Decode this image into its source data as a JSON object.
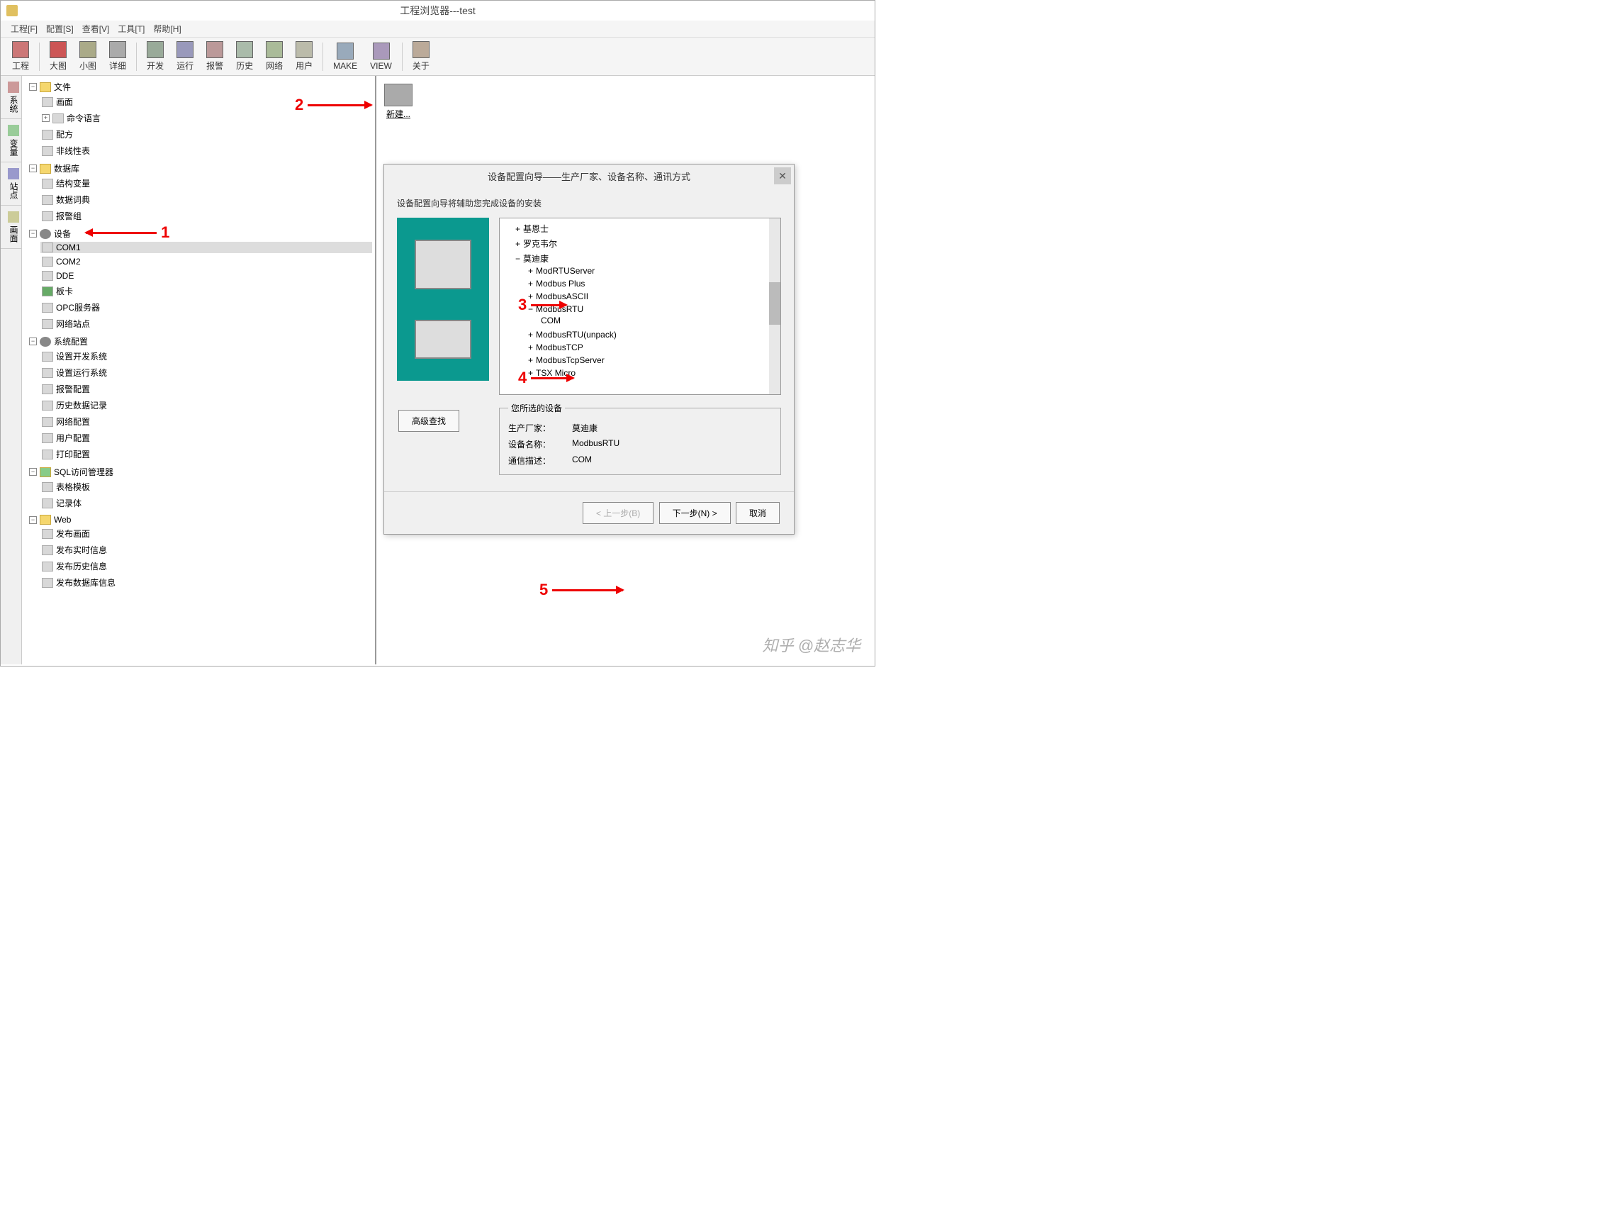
{
  "window": {
    "title": "工程浏览器---test"
  },
  "menubar": [
    "工程[F]",
    "配置[S]",
    "查看[V]",
    "工具[T]",
    "帮助[H]"
  ],
  "toolbar": [
    {
      "label": "工程"
    },
    {
      "sep": true
    },
    {
      "label": "大图"
    },
    {
      "label": "小图"
    },
    {
      "label": "详细"
    },
    {
      "sep": true
    },
    {
      "label": "开发"
    },
    {
      "label": "运行"
    },
    {
      "label": "报警"
    },
    {
      "label": "历史"
    },
    {
      "label": "网络"
    },
    {
      "label": "用户"
    },
    {
      "sep": true
    },
    {
      "label": "MAKE"
    },
    {
      "label": "VIEW"
    },
    {
      "sep": true
    },
    {
      "label": "关于"
    }
  ],
  "vtabs": [
    "系统",
    "变量",
    "站点",
    "画面"
  ],
  "tree": {
    "file": {
      "label": "文件",
      "children": [
        "画面",
        "命令语言",
        "配方",
        "非线性表"
      ]
    },
    "db": {
      "label": "数据库",
      "children": [
        "结构变量",
        "数据词典",
        "报警组"
      ]
    },
    "dev": {
      "label": "设备",
      "children": [
        "COM1",
        "COM2",
        "DDE",
        "板卡",
        "OPC服务器",
        "网络站点"
      ]
    },
    "cfg": {
      "label": "系统配置",
      "children": [
        "设置开发系统",
        "设置运行系统",
        "报警配置",
        "历史数据记录",
        "网络配置",
        "用户配置",
        "打印配置"
      ]
    },
    "sql": {
      "label": "SQL访问管理器",
      "children": [
        "表格模板",
        "记录体"
      ]
    },
    "web": {
      "label": "Web",
      "children": [
        "发布画面",
        "发布实时信息",
        "发布历史信息",
        "发布数据库信息"
      ]
    }
  },
  "content": {
    "new_label": "新建..."
  },
  "dialog": {
    "title": "设备配置向导——生产厂家、设备名称、通讯方式",
    "help": "设备配置向导将辅助您完成设备的安装",
    "tree": {
      "items": [
        "基恩士",
        "罗克韦尔"
      ],
      "open": {
        "label": "莫迪康",
        "children": [
          {
            "label": "ModRTUServer",
            "exp": "+"
          },
          {
            "label": "Modbus Plus",
            "exp": "+"
          },
          {
            "label": "ModbusASCII",
            "exp": "+"
          },
          {
            "label": "ModbusRTU",
            "exp": "-",
            "children": [
              "COM"
            ]
          },
          {
            "label": "ModbusRTU(unpack)",
            "exp": "+"
          },
          {
            "label": "ModbusTCP",
            "exp": "+"
          },
          {
            "label": "ModbusTcpServer",
            "exp": "+"
          },
          {
            "label": "TSX Micro",
            "exp": "+"
          }
        ]
      }
    },
    "selected": {
      "legend": "您所选的设备",
      "rows": [
        {
          "k": "生产厂家：",
          "v": "莫迪康"
        },
        {
          "k": "设备名称：",
          "v": "ModbusRTU"
        },
        {
          "k": "通信描述：",
          "v": "COM"
        }
      ]
    },
    "adv_btn": "高级查找",
    "prev_btn": "< 上一步(B)",
    "next_btn": "下一步(N) >",
    "cancel_btn": "取消"
  },
  "annotations": {
    "a1": "1",
    "a2": "2",
    "a3": "3",
    "a4": "4",
    "a5": "5"
  },
  "watermark": "知乎 @赵志华"
}
